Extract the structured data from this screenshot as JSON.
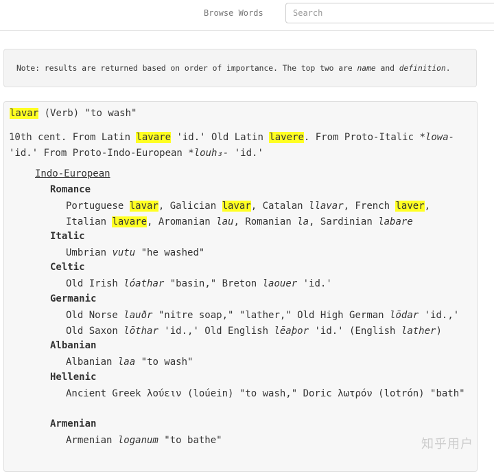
{
  "header": {
    "browse_label": "Browse Words",
    "search_placeholder": "Search"
  },
  "note": {
    "prefix": "Note: results are returned based on order of importance. The top two are ",
    "field1": "name",
    "conj": " and ",
    "field2": "definition",
    "suffix": "."
  },
  "entry": {
    "word": "lavar",
    "pos": "(Verb)",
    "gloss": "\"to wash\""
  },
  "etymology": {
    "p1": "10th cent. From Latin ",
    "latin": "lavare",
    "p2": " 'id.' Old Latin ",
    "old_latin": "lavere",
    "p3": ". From Proto-Italic *",
    "proto_italic": "lowa-",
    "p4": " 'id.' From Proto-Indo-European *",
    "pie": "louh₃-",
    "p5": " 'id.'"
  },
  "family": "Indo-European",
  "branches": {
    "romance": {
      "name": "Romance",
      "a": "Portuguese ",
      "w1": "lavar",
      "b": ", Galician ",
      "w2": "lavar",
      "c": ", Catalan ",
      "w3": "llavar",
      "d": ", French ",
      "w4": "laver",
      "e": ", Italian ",
      "w5": "lavare",
      "f": ", Aromanian ",
      "w6": "lau",
      "g": ", Romanian ",
      "w7": "la",
      "h": ", Sardinian ",
      "w8": "labare"
    },
    "italic": {
      "name": "Italic",
      "a": "Umbrian ",
      "w1": "vutu",
      "b": " \"he washed\""
    },
    "celtic": {
      "name": "Celtic",
      "a": "Old Irish ",
      "w1": "lóathar",
      "b": " \"basin,\" Breton ",
      "w2": "laouer",
      "c": " 'id.'"
    },
    "germanic": {
      "name": "Germanic",
      "a": "Old Norse ",
      "w1": "lauðr",
      "b": " \"nitre soap,\" \"lather,\" Old High German ",
      "w2": "lōdar",
      "c": " 'id.,' Old Saxon ",
      "w3": "lōthar",
      "d": " 'id.,' Old English ",
      "w4": "lēaþor",
      "e": " 'id.' (English ",
      "w5": "lather",
      "f": ")"
    },
    "albanian": {
      "name": "Albanian",
      "a": "Albanian ",
      "w1": "laa",
      "b": " \"to wash\""
    },
    "hellenic": {
      "name": "Hellenic",
      "a": "Ancient Greek ",
      "w1": "λούειν",
      "b": " (loúein) \"to wash,\" Doric ",
      "w2": "λωτρόν",
      "c": " (lotrón) \"bath\""
    },
    "armenian": {
      "name": "Armenian",
      "a": "Armenian ",
      "w1": "loganum",
      "b": " \"to bathe\""
    }
  },
  "watermark": "知乎用户",
  "colors": {
    "highlight": "#ffff22",
    "panel_bg": "#f7f7f7",
    "note_bg": "#f4f4f4"
  }
}
